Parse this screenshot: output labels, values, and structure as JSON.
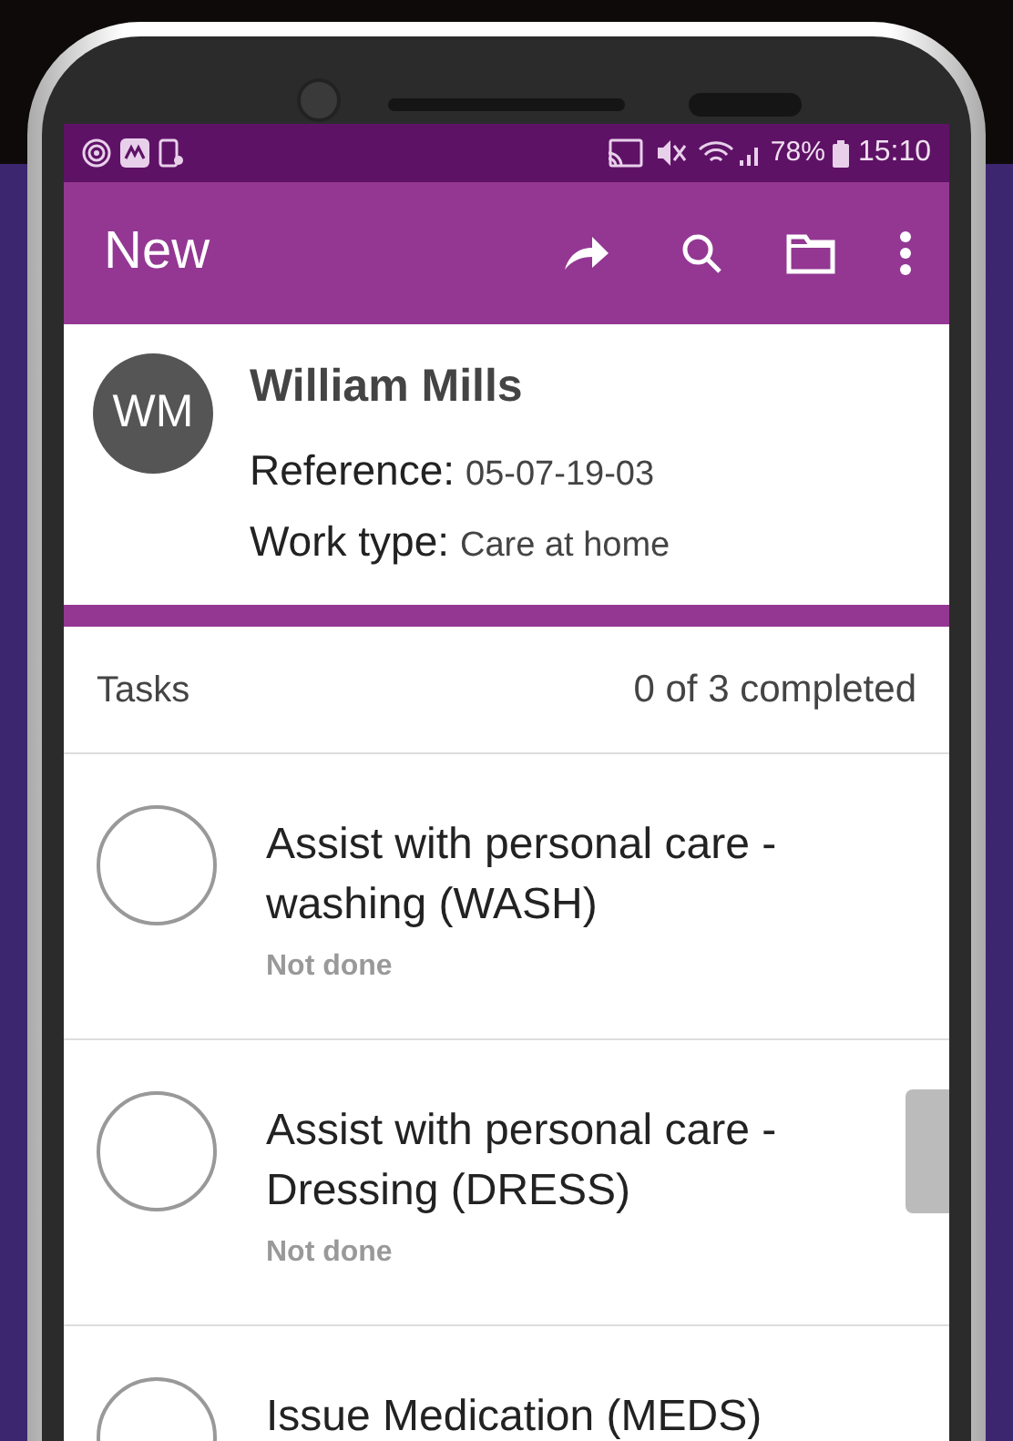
{
  "status_bar": {
    "battery": "78%",
    "time": "15:10"
  },
  "app_bar": {
    "title": "New"
  },
  "client": {
    "initials": "WM",
    "name": "William Mills",
    "fields": [
      {
        "label": "Reference:",
        "value": "05-07-19-03"
      },
      {
        "label": "Work type:",
        "value": "Care at home"
      }
    ]
  },
  "tasks": {
    "title": "Tasks",
    "summary": "0 of 3 completed",
    "items": [
      {
        "title": "Assist with personal care - washing (WASH)",
        "status": "Not done",
        "done": false
      },
      {
        "title": "Assist with personal care - Dressing (DRESS)",
        "status": "Not done",
        "done": false
      },
      {
        "title": "Issue Medication (MEDS)",
        "done": false
      }
    ]
  }
}
